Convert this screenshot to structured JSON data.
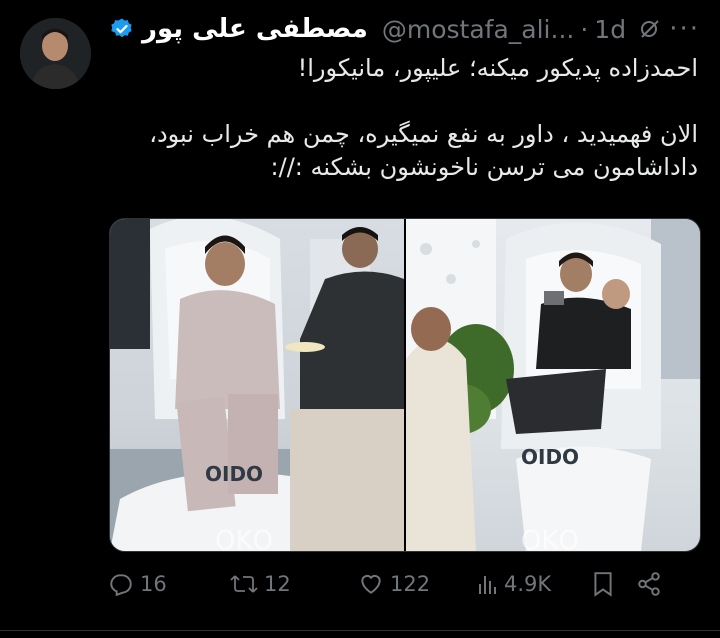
{
  "tweet": {
    "author_name": "مصطفی علی پور",
    "handle": "@mostafa_ali...",
    "separator": "·",
    "time": "1d",
    "more_label": "···",
    "lines": [
      "احمدزاده پدیکور میکنه؛ علیپور، مانیکورا!",
      "الان فهمیدید ، داور به نفع نمیگیره، چمن هم خراب نبود،",
      "داداشامون می ترسن ناخونشون بشکنه ://:"
    ]
  },
  "media": {
    "images": [
      {
        "watermark": "ΟΚΟ",
        "logo": "OIDO"
      },
      {
        "watermark": "ΟΚΟ",
        "logo": "OIDO"
      }
    ]
  },
  "actions": {
    "replies": "16",
    "retweets": "12",
    "likes": "122",
    "views": "4.9K"
  },
  "colors": {
    "background": "#000000",
    "text": "#e7e9ea",
    "secondary": "#71767b",
    "verified": "#1d9bf0"
  },
  "icons": [
    "verified-badge-icon",
    "grok-icon",
    "more-icon",
    "reply-icon",
    "retweet-icon",
    "like-icon",
    "views-icon",
    "bookmark-icon",
    "share-icon"
  ]
}
